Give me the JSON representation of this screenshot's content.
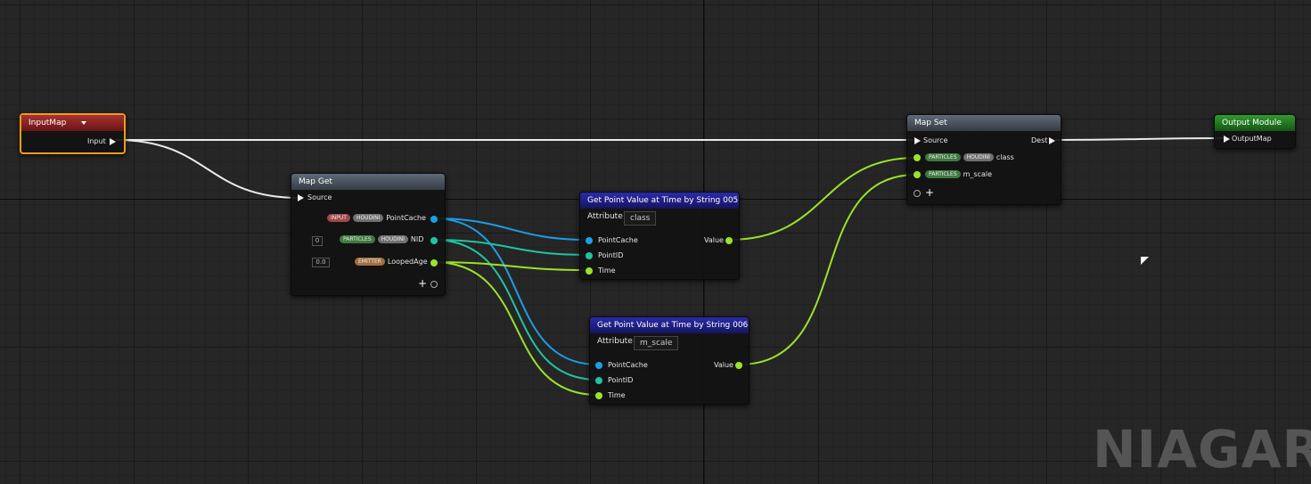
{
  "nodes": {
    "input_map": {
      "title": "InputMap",
      "pin_input": "Input"
    },
    "map_get": {
      "title": "Map Get",
      "source": "Source",
      "rows": [
        {
          "tags": [
            "INPUT",
            "HOUDINI"
          ],
          "label": "PointCache",
          "value": ""
        },
        {
          "tags": [
            "PARTICLES",
            "HOUDINI"
          ],
          "label": "NID",
          "value": "0"
        },
        {
          "tags": [
            "EMITTER"
          ],
          "label": "LoopedAge",
          "value": "0.0"
        }
      ]
    },
    "gpv_005": {
      "title": "Get Point Value at Time by String 005",
      "attribute_label": "Attribute",
      "attribute_value": "class",
      "in_pointcache": "PointCache",
      "in_pointid": "PointID",
      "in_time": "Time",
      "out_value": "Value"
    },
    "gpv_006": {
      "title": "Get Point Value at Time by String 006",
      "attribute_label": "Attribute",
      "attribute_value": "m_scale",
      "in_pointcache": "PointCache",
      "in_pointid": "PointID",
      "in_time": "Time",
      "out_value": "Value"
    },
    "map_set": {
      "title": "Map Set",
      "source": "Source",
      "dest": "Dest",
      "rows": [
        {
          "tags": [
            "PARTICLES",
            "HOUDINI"
          ],
          "label": "class"
        },
        {
          "tags": [
            "PARTICLES"
          ],
          "label": "m_scale"
        }
      ]
    },
    "output_module": {
      "title": "Output Module",
      "pin_output": "OutputMap"
    }
  },
  "watermark": "NIAGARA",
  "colors": {
    "background": "#262626",
    "pin_pointcache": "#1b9ee6",
    "pin_int": "#20c4a0",
    "pin_float": "#9be22a",
    "selection": "#f39c12"
  }
}
